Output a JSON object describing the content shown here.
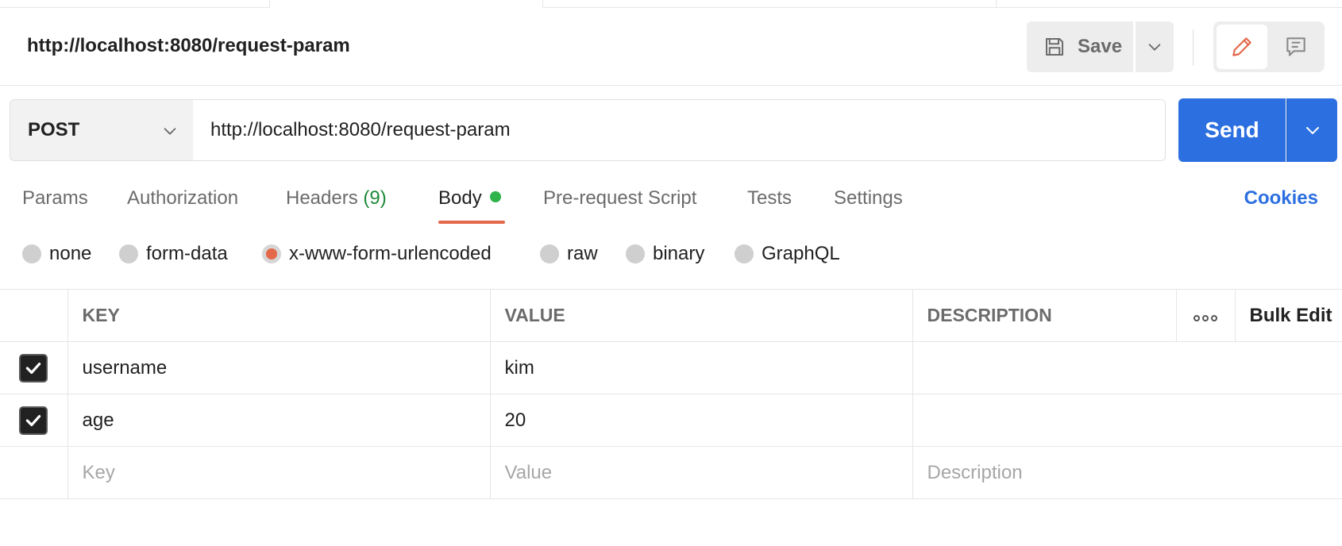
{
  "request": {
    "title": "http://localhost:8080/request-param",
    "method": "POST",
    "url": "http://localhost:8080/request-param"
  },
  "toolbar": {
    "save_label": "Save",
    "send_label": "Send"
  },
  "tabs": {
    "params": "Params",
    "authorization": "Authorization",
    "headers": "Headers",
    "headers_count": "(9)",
    "body": "Body",
    "pre_request": "Pre-request Script",
    "tests": "Tests",
    "settings": "Settings",
    "cookies": "Cookies",
    "active": "Body"
  },
  "body_types": {
    "none": "none",
    "form_data": "form-data",
    "urlencoded": "x-www-form-urlencoded",
    "raw": "raw",
    "binary": "binary",
    "graphql": "GraphQL",
    "selected": "x-www-form-urlencoded"
  },
  "table": {
    "headers": {
      "key": "KEY",
      "value": "VALUE",
      "description": "DESCRIPTION",
      "bulk_edit": "Bulk Edit"
    },
    "rows": [
      {
        "checked": true,
        "key": "username",
        "value": "kim",
        "description": ""
      },
      {
        "checked": true,
        "key": "age",
        "value": "20",
        "description": ""
      }
    ],
    "placeholder": {
      "key": "Key",
      "value": "Value",
      "description": "Description"
    }
  },
  "colors": {
    "accent_blue": "#2c6fe0",
    "accent_orange": "#e4684a",
    "active_dot_green": "#2db34a",
    "count_green": "#1f8a3b"
  },
  "icons": {
    "save": "floppy-disk-icon",
    "edit": "pencil-icon",
    "comment": "comment-icon",
    "chevron": "chevron-down-icon",
    "more": "more-horizontal-icon",
    "check": "check-icon"
  }
}
